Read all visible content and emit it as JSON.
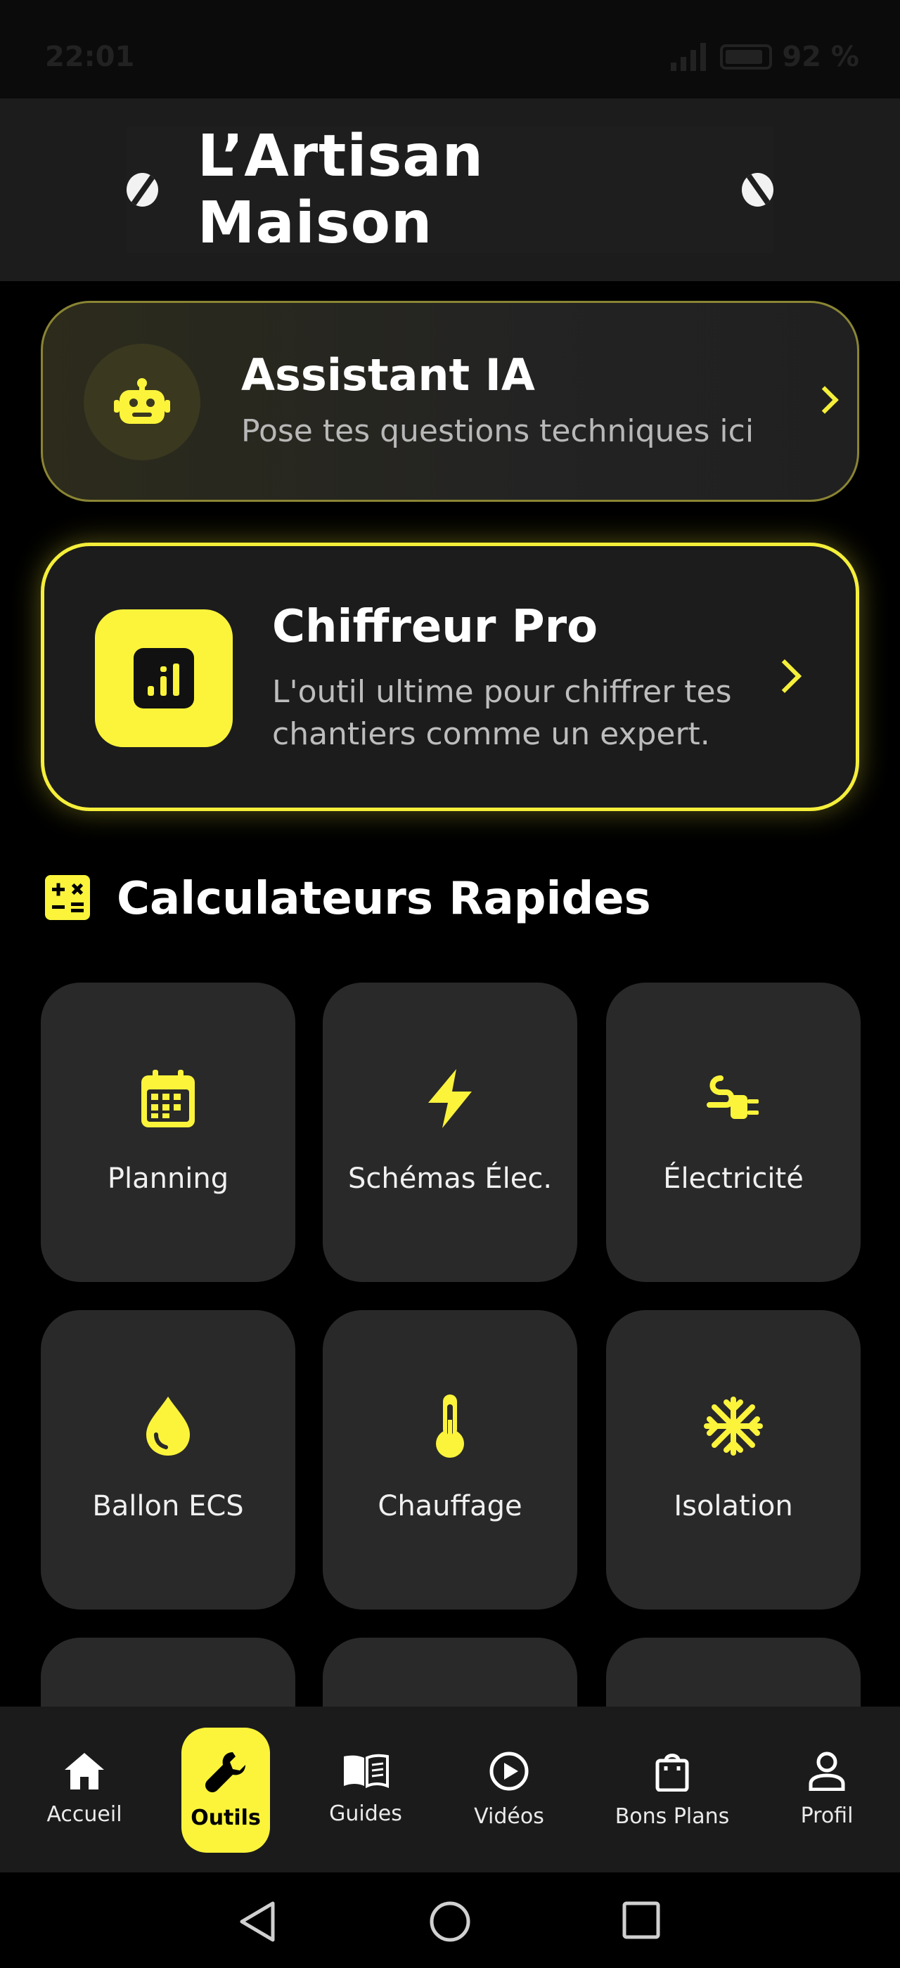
{
  "status": {
    "time": "22:01",
    "battery": "92 %"
  },
  "header": {
    "title": "L’Artisan Maison"
  },
  "ai_card": {
    "title": "Assistant IA",
    "subtitle": "Pose tes questions techniques ici",
    "icon": "robot-icon"
  },
  "pro_card": {
    "title": "Chiffreur Pro",
    "subtitle_line1": "L'outil ultime pour chiffrer tes",
    "subtitle_line2": "chantiers comme un expert.",
    "icon": "chart-icon"
  },
  "section": {
    "title": "Calculateurs Rapides",
    "icon": "calculator-icon"
  },
  "tiles": [
    {
      "label": "Planning",
      "icon": "calendar-icon"
    },
    {
      "label": "Schémas Élec.",
      "icon": "bolt-icon"
    },
    {
      "label": "Électricité",
      "icon": "plug-icon"
    },
    {
      "label": "Ballon ECS",
      "icon": "drop-icon"
    },
    {
      "label": "Chauffage",
      "icon": "thermometer-icon"
    },
    {
      "label": "Isolation",
      "icon": "snowflake-icon"
    }
  ],
  "nav": [
    {
      "label": "Accueil",
      "icon": "home-icon"
    },
    {
      "label": "Outils",
      "icon": "wrench-icon",
      "active": true
    },
    {
      "label": "Guides",
      "icon": "book-icon"
    },
    {
      "label": "Vidéos",
      "icon": "play-icon"
    },
    {
      "label": "Bons Plans",
      "icon": "bag-icon"
    },
    {
      "label": "Profil",
      "icon": "person-icon"
    }
  ],
  "colors": {
    "accent": "#fbf43b",
    "card": "#292929",
    "background": "#000000"
  }
}
